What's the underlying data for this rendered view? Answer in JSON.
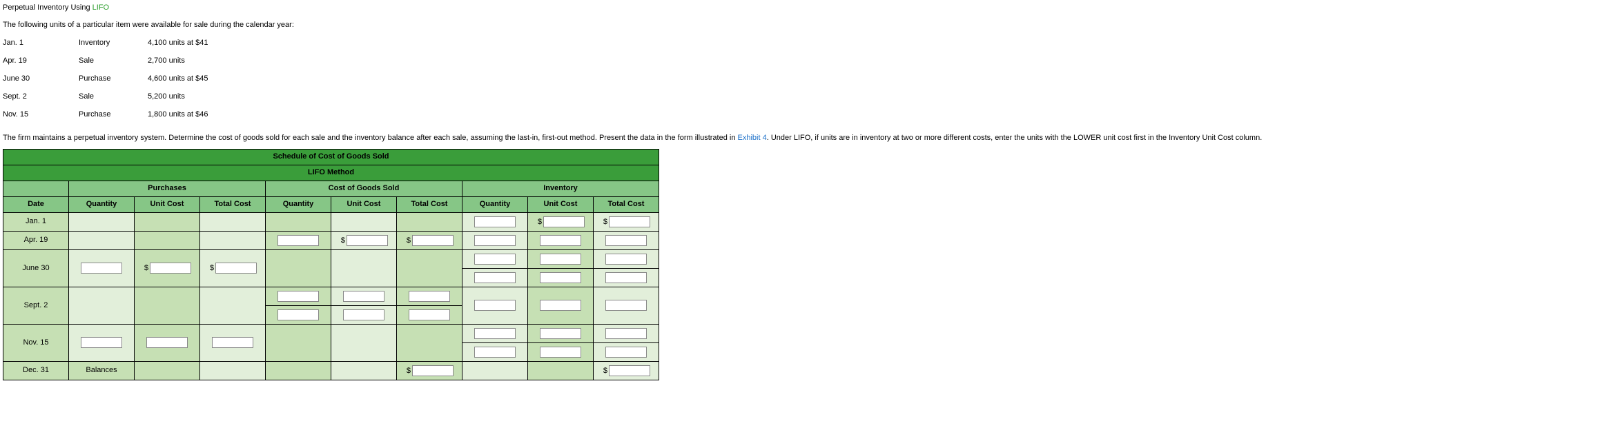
{
  "title_prefix": "Perpetual Inventory Using ",
  "title_lifo": "LIFO",
  "intro": "The following units of a particular item were available for sale during the calendar year:",
  "given": [
    {
      "date": "Jan. 1",
      "type": "Inventory",
      "desc": "4,100 units at $41"
    },
    {
      "date": "Apr. 19",
      "type": "Sale",
      "desc": "2,700 units"
    },
    {
      "date": "June 30",
      "type": "Purchase",
      "desc": "4,600 units at $45"
    },
    {
      "date": "Sept. 2",
      "type": "Sale",
      "desc": "5,200 units"
    },
    {
      "date": "Nov. 15",
      "type": "Purchase",
      "desc": "1,800 units at $46"
    }
  ],
  "instr_before": "The firm maintains a perpetual inventory system. Determine the cost of goods sold for each sale and the inventory balance after each sale, assuming the last-in, first-out method. Present the data in the form illustrated in ",
  "exhibit_link": "Exhibit 4",
  "instr_after": ". Under LIFO, if units are in inventory at two or more different costs, enter the units with the LOWER unit cost first in the Inventory Unit Cost column.",
  "sched_title1": "Schedule of Cost of Goods Sold",
  "sched_title2": "LIFO Method",
  "group_purchases": "Purchases",
  "group_cogs": "Cost of Goods Sold",
  "group_inv": "Inventory",
  "col_date": "Date",
  "col_qty": "Quantity",
  "col_unit": "Unit Cost",
  "col_total": "Total Cost",
  "rows": {
    "jan1": "Jan. 1",
    "apr19": "Apr. 19",
    "jun30": "June 30",
    "sep2": "Sept. 2",
    "nov15": "Nov. 15",
    "dec31": "Dec. 31"
  },
  "balances": "Balances",
  "dollar": "$"
}
